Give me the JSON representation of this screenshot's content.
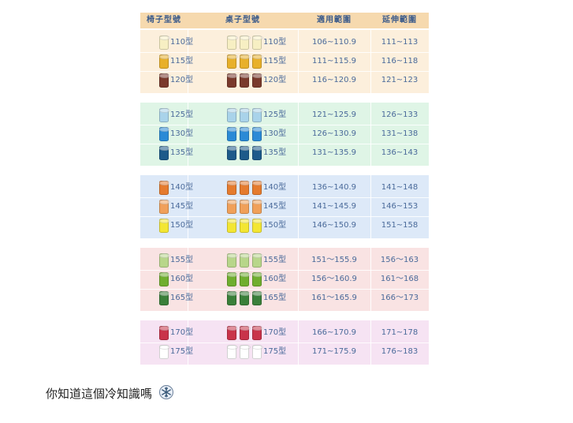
{
  "table": {
    "headers": [
      "椅子型號",
      "桌子型號",
      "適用範圍",
      "延伸範圍"
    ],
    "groups": [
      {
        "bg": "#fcefdc",
        "rows": [
          {
            "chair": "110型",
            "desk": "110型",
            "range": "106~110.9",
            "ext": "111~113",
            "color": "#f7efc3"
          },
          {
            "chair": "115型",
            "desk": "115型",
            "range": "111~115.9",
            "ext": "116~118",
            "color": "#e8b02a"
          },
          {
            "chair": "120型",
            "desk": "120型",
            "range": "116~120.9",
            "ext": "121~123",
            "color": "#7a3a2c"
          }
        ]
      },
      {
        "bg": "#dff5e6",
        "rows": [
          {
            "chair": "125型",
            "desk": "125型",
            "range": "121~125.9",
            "ext": "126~133",
            "color": "#a9d3ea"
          },
          {
            "chair": "130型",
            "desk": "130型",
            "range": "126~130.9",
            "ext": "131~138",
            "color": "#2b8ad6"
          },
          {
            "chair": "135型",
            "desk": "135型",
            "range": "131~135.9",
            "ext": "136~143",
            "color": "#1d5a8a"
          }
        ]
      },
      {
        "bg": "#dde9f8",
        "rows": [
          {
            "chair": "140型",
            "desk": "140型",
            "range": "136~140.9",
            "ext": "141~148",
            "color": "#e57b2e"
          },
          {
            "chair": "145型",
            "desk": "145型",
            "range": "141~145.9",
            "ext": "146~153",
            "color": "#f0a05a"
          },
          {
            "chair": "150型",
            "desk": "150型",
            "range": "146~150.9",
            "ext": "151~158",
            "color": "#f3e633"
          }
        ]
      },
      {
        "bg": "#f9e3e3",
        "rows": [
          {
            "chair": "155型",
            "desk": "155型",
            "range": "151～155.9",
            "ext": "156～163",
            "color": "#b8d68a"
          },
          {
            "chair": "160型",
            "desk": "160型",
            "range": "156～160.9",
            "ext": "161～168",
            "color": "#6fae2f"
          },
          {
            "chair": "165型",
            "desk": "165型",
            "range": "161～165.9",
            "ext": "166～173",
            "color": "#3a7f3a"
          }
        ]
      },
      {
        "bg": "#f6e3f3",
        "rows": [
          {
            "chair": "170型",
            "desk": "170型",
            "range": "166~170.9",
            "ext": "171~178",
            "color": "#c9334a"
          },
          {
            "chair": "175型",
            "desk": "175型",
            "range": "171~175.9",
            "ext": "176~183",
            "color": "#ffffff"
          }
        ]
      }
    ]
  },
  "caption": "你知道這個冷知識嗎",
  "caption_icon": "snowflake-icon",
  "colors": {
    "header_bg": "#f6d9ae",
    "header_text": "#3a5a8a",
    "cell_text": "#4a6a9a"
  }
}
